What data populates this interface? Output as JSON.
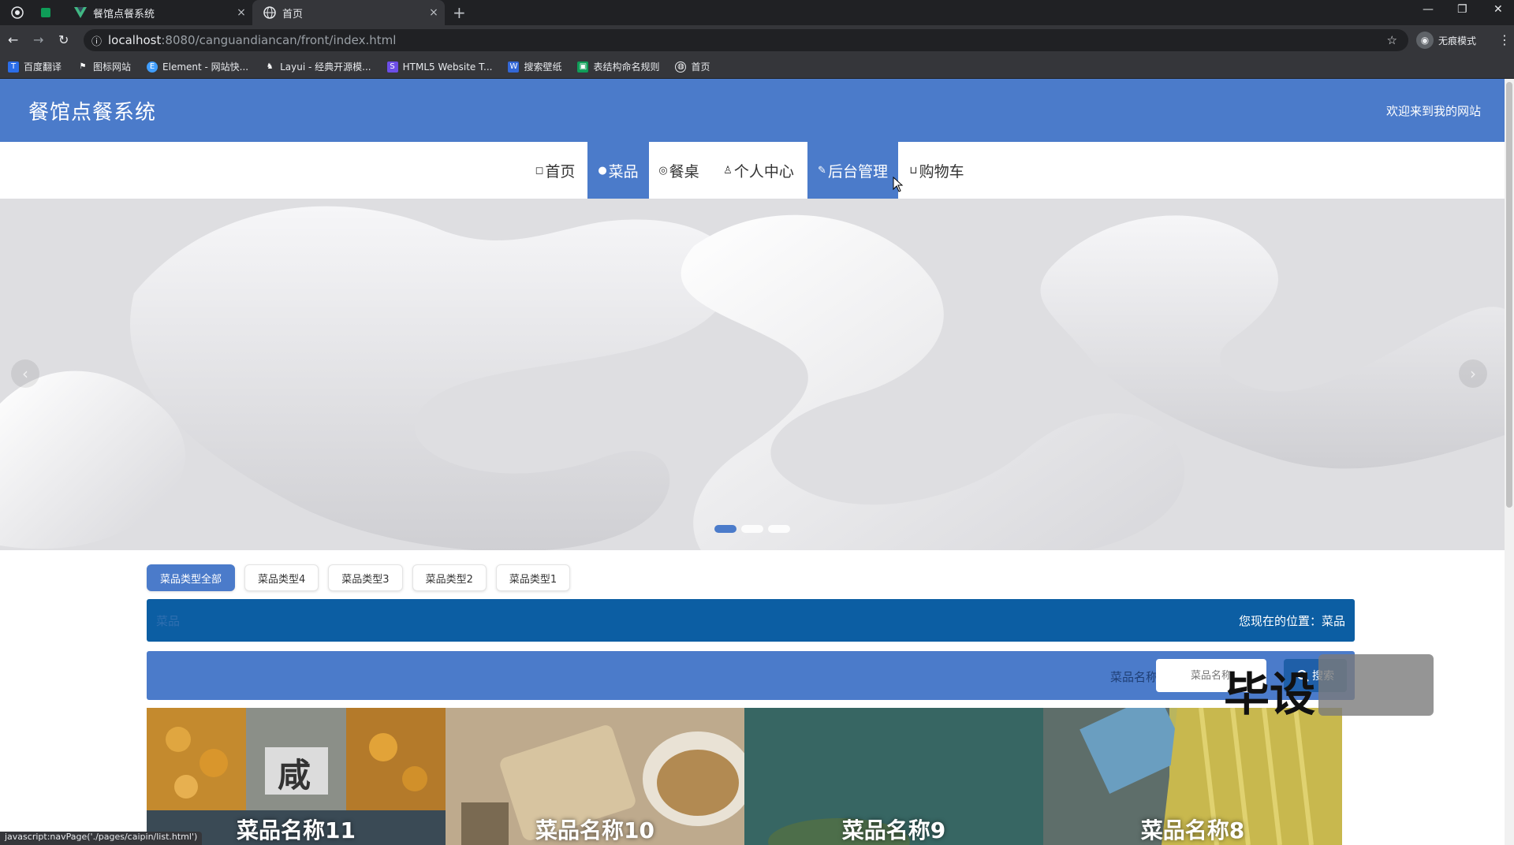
{
  "browser": {
    "tabs": [
      {
        "title": "餐馆点餐系统",
        "close": "×"
      },
      {
        "title": "首页",
        "close": "×"
      }
    ],
    "new_tab": "+",
    "url_host": "localhost",
    "url_path": ":8080/canguandiancan/front/index.html",
    "incognito_label": "无痕模式",
    "bookmarks": [
      "百度翻译",
      "图标网站",
      "Element - 网站快...",
      "Layui - 经典开源模...",
      "HTML5 Website T...",
      "搜索壁纸",
      "表结构命名规则",
      "首页"
    ],
    "status_url": "javascript:navPage('./pages/caipin/list.html')"
  },
  "header": {
    "title": "餐馆点餐系统",
    "welcome": "欢迎来到我的网站"
  },
  "nav": {
    "items": [
      {
        "label": "首页",
        "icon": "◻"
      },
      {
        "label": "菜品",
        "icon": "●"
      },
      {
        "label": "餐桌",
        "icon": "◎"
      },
      {
        "label": "个人中心",
        "icon": "♙"
      },
      {
        "label": "后台管理",
        "icon": "✎"
      },
      {
        "label": "购物车",
        "icon": "⊔"
      }
    ],
    "active": [
      "菜品",
      "后台管理"
    ]
  },
  "banner": {
    "prev": "‹",
    "next": "›",
    "slides": 3,
    "active_slide": 1
  },
  "categories": [
    "菜品类型全部",
    "菜品类型4",
    "菜品类型3",
    "菜品类型2",
    "菜品类型1"
  ],
  "location": {
    "title": "菜品",
    "text": "您现在的位置：菜品"
  },
  "search": {
    "label": "菜品名称",
    "placeholder": "菜品名称",
    "button": "搜索"
  },
  "products": [
    "菜品名称11",
    "菜品名称10",
    "菜品名称9",
    "菜品名称8"
  ],
  "overlay": {
    "watermark": "毕设"
  },
  "colors": {
    "header": "#4b7bca",
    "nav_active": "#4b7bca",
    "location_bar": "#0c5ea3"
  }
}
